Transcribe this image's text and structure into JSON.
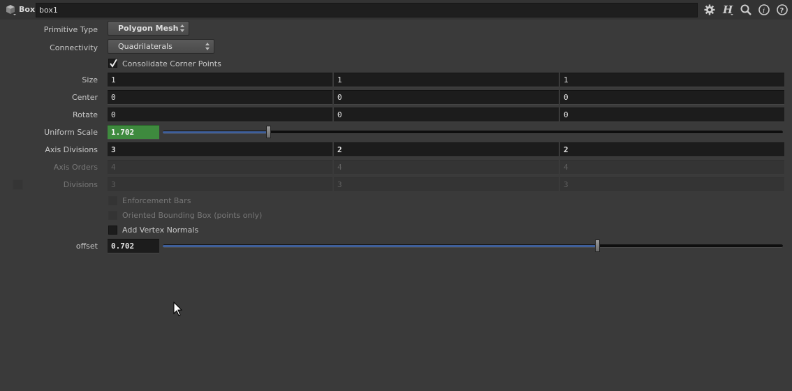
{
  "header": {
    "node_type": "Box",
    "node_name": "box1",
    "icons": [
      "gear-icon",
      "houdini-help-icon",
      "search-icon",
      "info-icon",
      "help-icon"
    ]
  },
  "params": {
    "primitive_type": {
      "label": "Primitive Type",
      "value": "Polygon Mesh"
    },
    "connectivity": {
      "label": "Connectivity",
      "value": "Quadrilaterals"
    },
    "consolidate": {
      "label": "Consolidate Corner Points",
      "checked": true
    },
    "size": {
      "label": "Size",
      "values": [
        "1",
        "1",
        "1"
      ]
    },
    "center": {
      "label": "Center",
      "values": [
        "0",
        "0",
        "0"
      ]
    },
    "rotate": {
      "label": "Rotate",
      "values": [
        "0",
        "0",
        "0"
      ]
    },
    "uniform_scale": {
      "label": "Uniform Scale",
      "value": "1.702"
    },
    "axis_divisions": {
      "label": "Axis Divisions",
      "values": [
        "3",
        "2",
        "2"
      ]
    },
    "axis_orders": {
      "label": "Axis Orders",
      "values": [
        "4",
        "4",
        "4"
      ]
    },
    "divisions": {
      "label": "Divisions",
      "values": [
        "3",
        "3",
        "3"
      ]
    },
    "enforcement_bars": {
      "label": "Enforcement Bars"
    },
    "oriented_bbox": {
      "label": "Oriented Bounding Box (points only)"
    },
    "vertex_normals": {
      "label": "Add Vertex Normals",
      "checked": false
    },
    "offset": {
      "label": "offset",
      "value": "0.702"
    }
  },
  "colors": {
    "accent_green": "#3e8a3e",
    "slider_blue": "#3f5f9a"
  }
}
